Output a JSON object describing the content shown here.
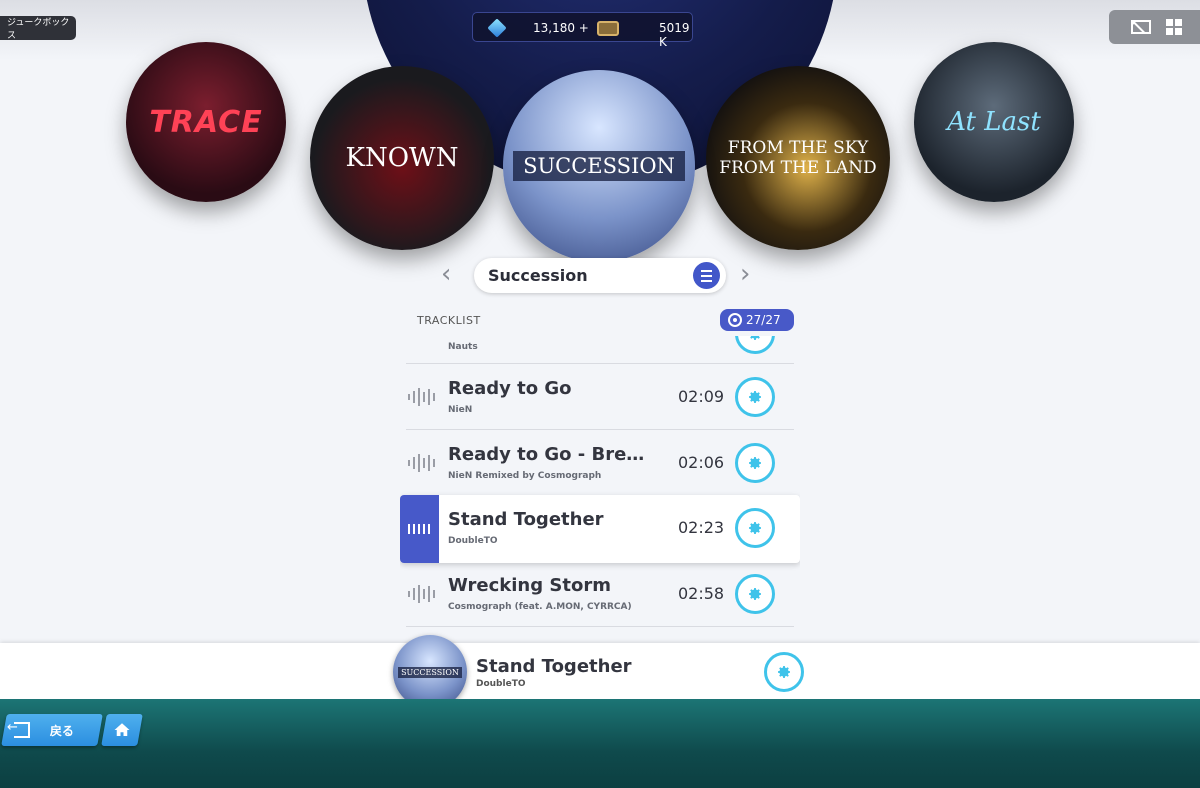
{
  "screen_label": "ジュークボックス",
  "currency": {
    "gems": "13,180 +",
    "tickets": "5019 K"
  },
  "albums": [
    {
      "name": "TRACE",
      "title_text": "TRACE"
    },
    {
      "name": "KNOWN",
      "title_text": "KNOWN"
    },
    {
      "name": "SUCCESSION",
      "title_text": "SUCCESSION"
    },
    {
      "name": "FROM THE SKY FROM THE LAND",
      "title_text": "FROM THE SKY FROM THE LAND"
    },
    {
      "name": "At Last",
      "title_text": "At Last"
    }
  ],
  "selected_album": "Succession",
  "tracklist": {
    "label": "TRACKLIST",
    "count": "27/27",
    "partial_artist": "Nauts",
    "tracks": [
      {
        "title": "Ready to Go",
        "artist": "NieN",
        "duration": "02:09"
      },
      {
        "title": "Ready to Go - Break...",
        "artist": "NieN Remixed by Cosmograph",
        "duration": "02:06"
      },
      {
        "title": "Stand Together",
        "artist": "DoubleTO",
        "duration": "02:23"
      },
      {
        "title": "Wrecking Storm",
        "artist": "Cosmograph (feat. A.MON, CYRRCA)",
        "duration": "02:58"
      }
    ]
  },
  "now_playing": {
    "title": "Stand Together",
    "artist": "DoubleTO",
    "jacket_text": "SUCCESSION"
  },
  "footer": {
    "back_label": "戻る"
  },
  "colors": {
    "accent": "#4759c9",
    "gear": "#3fc3ea",
    "footer": "#0f4a4c"
  }
}
